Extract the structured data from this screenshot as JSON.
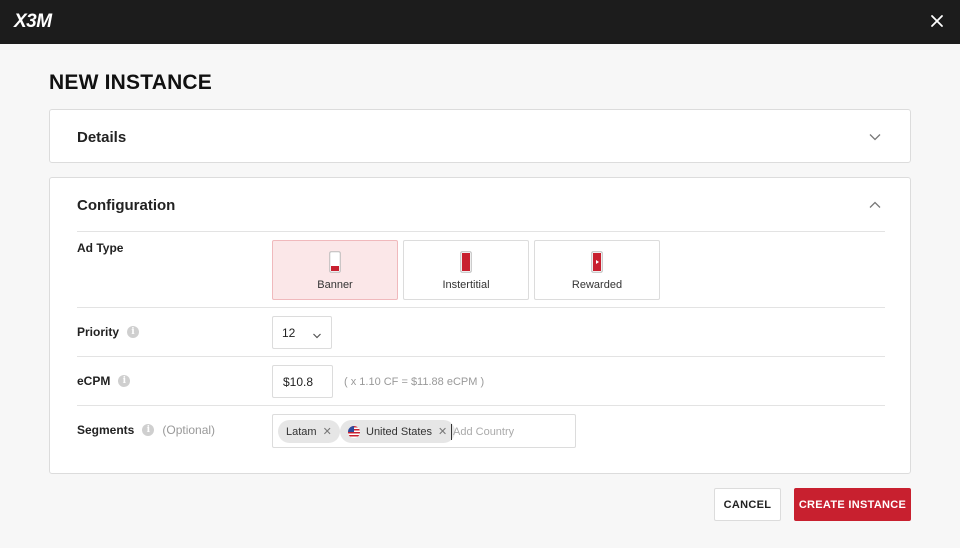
{
  "app": {
    "logo_text": "X3M",
    "close_icon": "close-icon"
  },
  "page": {
    "title": "NEW INSTANCE"
  },
  "details": {
    "title": "Details",
    "expanded": false
  },
  "configuration": {
    "title": "Configuration",
    "expanded": true,
    "ad_type": {
      "label": "Ad Type",
      "options": [
        {
          "label": "Banner",
          "icon": "banner-phone-icon",
          "selected": true
        },
        {
          "label": "Instertitial",
          "icon": "interstitial-phone-icon",
          "selected": false
        },
        {
          "label": "Rewarded",
          "icon": "rewarded-phone-icon",
          "selected": false
        }
      ]
    },
    "priority": {
      "label": "Priority",
      "value": "12"
    },
    "ecpm": {
      "label": "eCPM",
      "value": "$10.8",
      "note": "( x 1.10 CF = $11.88 eCPM )"
    },
    "segments": {
      "label": "Segments",
      "optional": "(Optional)",
      "chips": [
        {
          "label": "Latam",
          "flag": null
        },
        {
          "label": "United States",
          "flag": "us-flag-icon"
        }
      ],
      "placeholder": "Add Country"
    }
  },
  "actions": {
    "cancel": "CANCEL",
    "create": "CREATE INSTANCE"
  },
  "colors": {
    "accent": "#c8202f",
    "topbar": "#1c1c1c",
    "selected_bg": "#fbe7e8"
  }
}
